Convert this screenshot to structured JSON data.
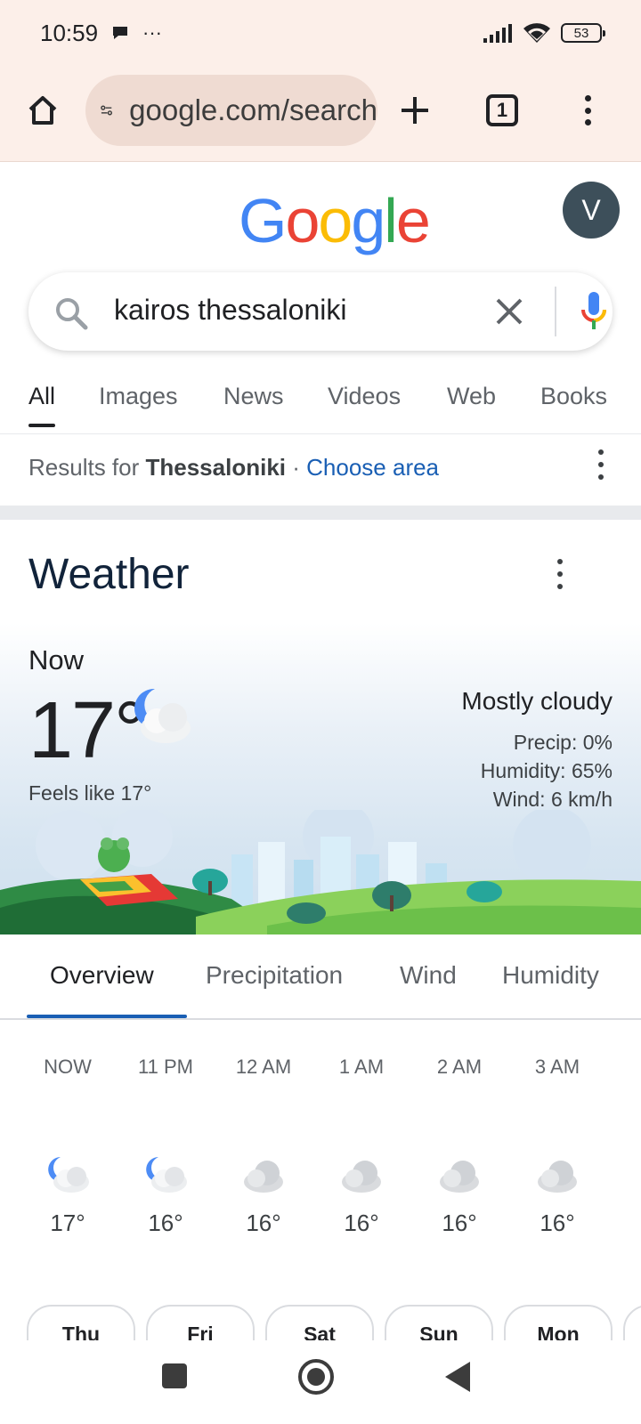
{
  "status_bar": {
    "time": "10:59",
    "more": "···",
    "battery": "53"
  },
  "toolbar": {
    "url": "google.com/search",
    "tab_count": "1"
  },
  "google": {
    "logo_letters": [
      "G",
      "o",
      "o",
      "g",
      "l",
      "e"
    ],
    "logo_colors": [
      "#4285F4",
      "#EA4335",
      "#FBBC05",
      "#4285F4",
      "#34A853",
      "#EA4335"
    ],
    "avatar_initial": "V"
  },
  "search": {
    "query": "kairos thessaloniki"
  },
  "tabs": [
    {
      "label": "All",
      "active": true
    },
    {
      "label": "Images"
    },
    {
      "label": "News"
    },
    {
      "label": "Videos"
    },
    {
      "label": "Web"
    },
    {
      "label": "Books"
    }
  ],
  "results_for": {
    "prefix": "Results for",
    "place": "Thessaloniki",
    "dot": "·",
    "choose_area": "Choose area"
  },
  "weather": {
    "title": "Weather",
    "now_label": "Now",
    "temperature": "17°",
    "feels_like": "Feels like 17°",
    "condition": "Mostly cloudy",
    "precip": "Precip: 0%",
    "humidity": "Humidity: 65%",
    "wind": "Wind: 6 km/h",
    "tabs": [
      "Overview",
      "Precipitation",
      "Wind",
      "Humidity"
    ],
    "hourly": [
      {
        "time": "NOW",
        "temp": "17°",
        "icon": "moon-cloud-icon"
      },
      {
        "time": "11 PM",
        "temp": "16°",
        "icon": "moon-cloud-icon"
      },
      {
        "time": "12 AM",
        "temp": "16°",
        "icon": "cloud-icon"
      },
      {
        "time": "1 AM",
        "temp": "16°",
        "icon": "cloud-icon"
      },
      {
        "time": "2 AM",
        "temp": "16°",
        "icon": "cloud-icon"
      },
      {
        "time": "3 AM",
        "temp": "16°",
        "icon": "cloud-icon"
      }
    ],
    "days": [
      "Thu",
      "Fri",
      "Sat",
      "Sun",
      "Mon"
    ]
  },
  "colors": {
    "toolbar_bg": "#fcefe9",
    "link_blue": "#1a5fb4",
    "accent_underline": "#1a5fb4"
  }
}
